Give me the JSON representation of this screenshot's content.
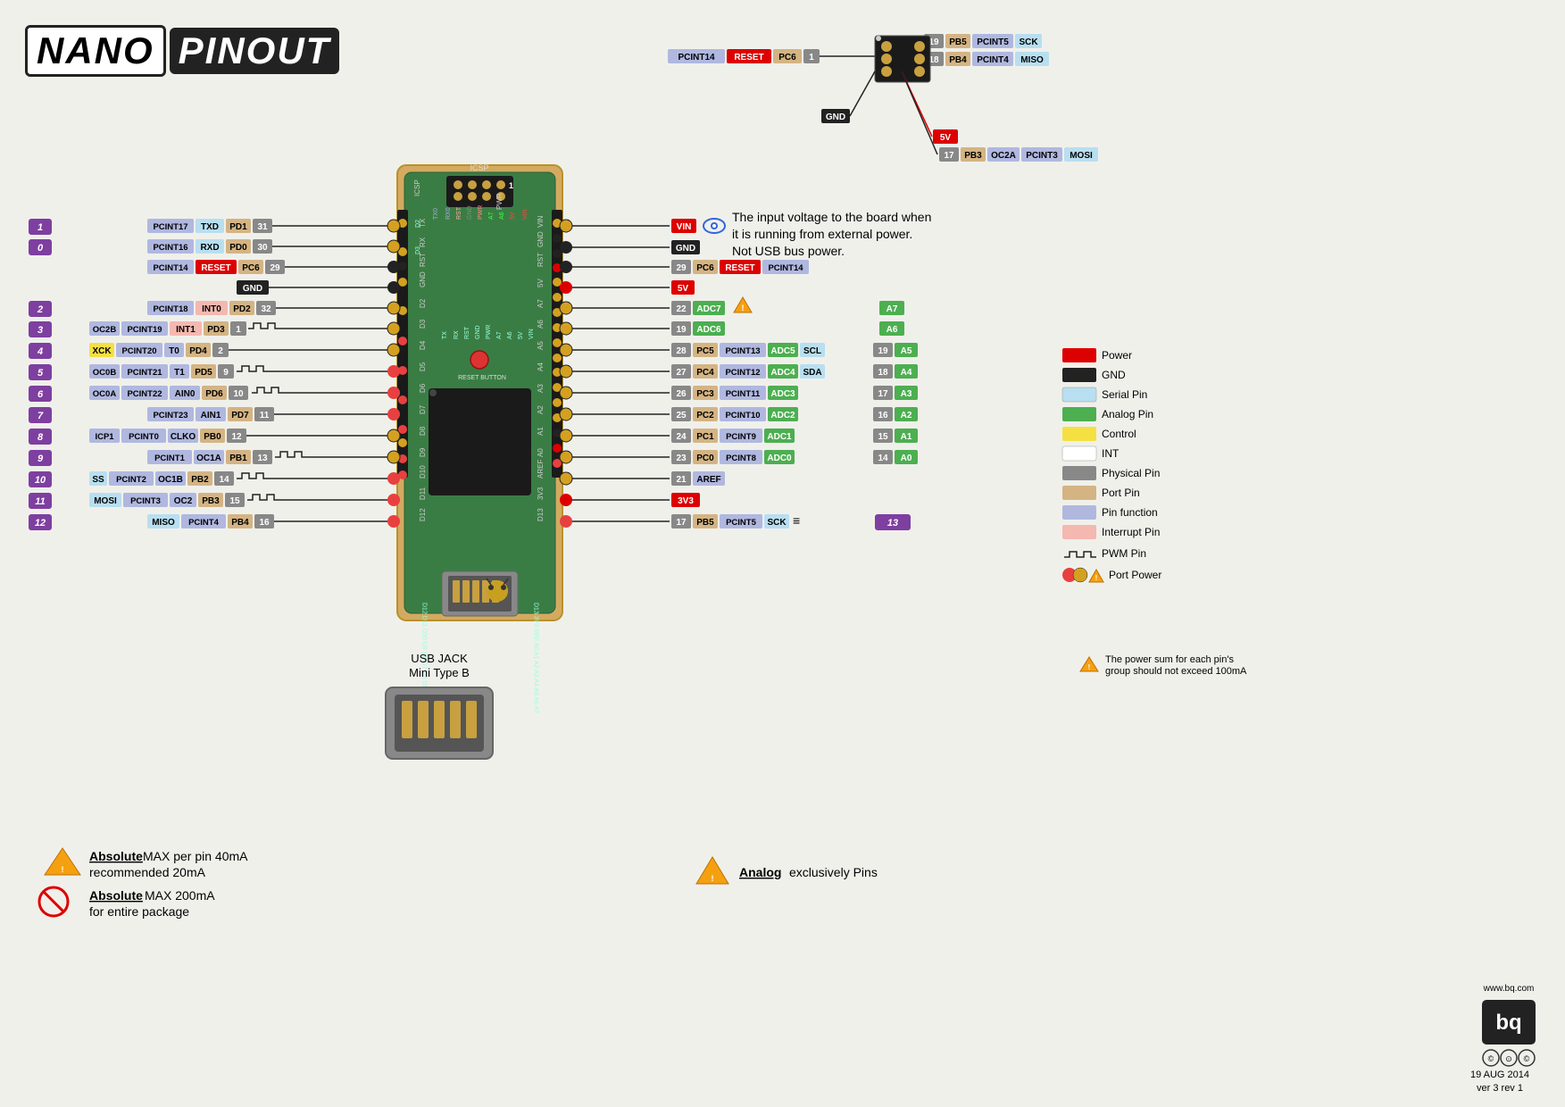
{
  "title": {
    "nano": "NANO",
    "pinout": "PINOUT"
  },
  "legend": {
    "items": [
      {
        "label": "Power",
        "color": "#dd0000"
      },
      {
        "label": "GND",
        "color": "#222222"
      },
      {
        "label": "Serial Pin",
        "color": "#b8dff0"
      },
      {
        "label": "Analog Pin",
        "color": "#4caf50"
      },
      {
        "label": "Control",
        "color": "#f5e042"
      },
      {
        "label": "INT",
        "color": "#ffffff"
      },
      {
        "label": "Physical Pin",
        "color": "#888888"
      },
      {
        "label": "Port Pin",
        "color": "#d4b483"
      },
      {
        "label": "Pin function",
        "color": "#b0b8e0"
      },
      {
        "label": "Interrupt Pin",
        "color": "#f4b8b0"
      },
      {
        "label": "PWM Pin",
        "color": "#e8e8e8"
      },
      {
        "label": "Port Power",
        "color": "#special"
      }
    ]
  },
  "info": {
    "vin_label": "VIN",
    "vin_desc": "The input voltage to the board when it is running from external power. Not USB bus power."
  },
  "left_pins": [
    {
      "num": "1",
      "pcint": "PCINT17",
      "name": "TXD",
      "port": "PD1",
      "phys": "31"
    },
    {
      "num": "0",
      "pcint": "PCINT16",
      "name": "RXD",
      "port": "PD0",
      "phys": "30"
    },
    {
      "num": "",
      "pcint": "PCINT14",
      "name": "RESET",
      "port": "PC6",
      "phys": "29"
    },
    {
      "num": "",
      "pcint": "",
      "name": "GND",
      "port": "",
      "phys": ""
    },
    {
      "num": "2",
      "pcint": "PCINT18",
      "name": "INT0",
      "port": "PD2",
      "phys": "32"
    },
    {
      "num": "3",
      "pcint": "PCINT19",
      "name": "INT1",
      "port": "PD3",
      "phys": "1",
      "extra": "OC2B"
    },
    {
      "num": "4",
      "pcint": "PCINT20",
      "name": "T0",
      "port": "PD4",
      "phys": "2",
      "extra": "XCK"
    },
    {
      "num": "5",
      "pcint": "PCINT21",
      "name": "T1",
      "port": "PD5",
      "phys": "9",
      "extra": "OC0B"
    },
    {
      "num": "6",
      "pcint": "PCINT22",
      "name": "AIN0",
      "port": "PD6",
      "phys": "10",
      "extra": "OC0A"
    },
    {
      "num": "7",
      "pcint": "PCINT23",
      "name": "AIN1",
      "port": "PD7",
      "phys": "11"
    },
    {
      "num": "8",
      "pcint": "PCINT0",
      "name": "CLKO",
      "port": "PB0",
      "phys": "12",
      "extra": "ICP1"
    },
    {
      "num": "9",
      "pcint": "PCINT1",
      "name": "OC1A",
      "port": "PB1",
      "phys": "13"
    },
    {
      "num": "10",
      "pcint": "PCINT2",
      "name": "OC1B",
      "port": "PB2",
      "phys": "14",
      "extra": "SS"
    },
    {
      "num": "11",
      "pcint": "PCINT3",
      "name": "OC2",
      "port": "PB3",
      "phys": "15",
      "extra": "MOSI"
    },
    {
      "num": "12",
      "pcint": "PCINT4",
      "name": "MISO",
      "port": "PB4",
      "phys": "16"
    }
  ],
  "right_pins": [
    {
      "name": "VIN",
      "color": "power"
    },
    {
      "name": "GND",
      "color": "gnd"
    },
    {
      "pcint": "PCINT14",
      "name": "RESET",
      "port": "PC6",
      "phys": "29"
    },
    {
      "name": "5V",
      "color": "power"
    },
    {
      "port": "ADC7",
      "phys": "22",
      "analog": "A7"
    },
    {
      "port": "ADC6",
      "phys": "19",
      "analog": "A6"
    },
    {
      "pcint": "PCINT13",
      "port": "PC5",
      "phys": "28",
      "func": "ADC5",
      "extra": "SCL",
      "arduino": "A5",
      "anum": "19"
    },
    {
      "pcint": "PCINT12",
      "port": "PC4",
      "phys": "27",
      "func": "ADC4",
      "extra": "SDA",
      "arduino": "A4",
      "anum": "18"
    },
    {
      "pcint": "PCINT11",
      "port": "PC3",
      "phys": "26",
      "func": "ADC3",
      "arduino": "A3",
      "anum": "17"
    },
    {
      "pcint": "PCINT10",
      "port": "PC2",
      "phys": "25",
      "func": "ADC2",
      "arduino": "A2",
      "anum": "16"
    },
    {
      "pcint": "PCINT9",
      "port": "PC1",
      "phys": "24",
      "func": "ADC1",
      "arduino": "A1",
      "anum": "15"
    },
    {
      "pcint": "PCINT8",
      "port": "PC0",
      "phys": "23",
      "func": "ADC0",
      "arduino": "A0",
      "anum": "14"
    },
    {
      "name": "AREF",
      "phys": "21"
    },
    {
      "name": "3V3",
      "color": "power"
    },
    {
      "pcint": "PCINT5",
      "port": "PB5",
      "phys": "17",
      "func": "SCK",
      "arduino": "13"
    }
  ],
  "bottom": {
    "note1": "Absolute MAX per pin 40mA",
    "note1b": "recommended 20mA",
    "note2": "Absolute MAX 200mA",
    "note2b": "for entire package",
    "usb_label": "USB JACK",
    "usb_type": "Mini Type B",
    "analog_note": "Analog exclusively Pins",
    "power_sum_note": "The power sum for each pin's group should not exceed 100mA"
  },
  "top_right": {
    "reset_label": "RESET",
    "pc6": "PC6",
    "phys1": "1",
    "pb5": "PB5",
    "pcint5_top": "PCINT5",
    "sck": "SCK",
    "phys19": "19",
    "pb4": "PB4",
    "pcint4": "PCINT4",
    "miso": "MISO",
    "phys18": "18",
    "gnd_top": "GND",
    "fivev_top": "5V",
    "pb3": "PB3",
    "oc2a": "OC2A",
    "pcint3": "PCINT3",
    "mosi": "MOSI",
    "phys17": "17"
  },
  "version": {
    "date": "19 AUG 2014",
    "ver": "ver 3 rev 1"
  }
}
